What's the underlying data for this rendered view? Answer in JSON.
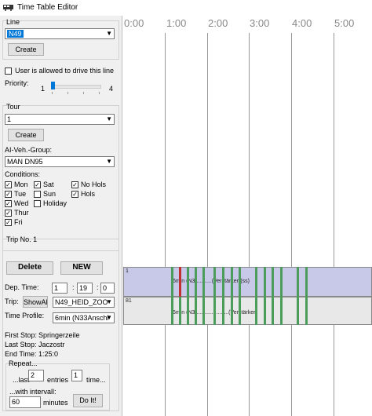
{
  "window": {
    "title": "Time Table Editor"
  },
  "line": {
    "group_label": "Line",
    "value": "N49",
    "create_label": "Create"
  },
  "permission": {
    "label": "User is allowed to drive this line",
    "checked": false
  },
  "priority": {
    "label": "Priority:",
    "min": "1",
    "max": "4",
    "value": 1
  },
  "tour": {
    "group_label": "Tour",
    "value": "1",
    "create_label": "Create"
  },
  "vehicle": {
    "label": "AI-Veh.-Group:",
    "value": "MAN DN95"
  },
  "conditions": {
    "label": "Conditions:",
    "items": [
      {
        "label": "Mon",
        "checked": true
      },
      {
        "label": "Tue",
        "checked": true
      },
      {
        "label": "Wed",
        "checked": true
      },
      {
        "label": "Thur",
        "checked": true
      },
      {
        "label": "Fri",
        "checked": true
      },
      {
        "label": "Sat",
        "checked": true
      },
      {
        "label": "Sun",
        "checked": false
      },
      {
        "label": "Holiday",
        "checked": false
      },
      {
        "label": "No Hols",
        "checked": true
      },
      {
        "label": "Hols",
        "checked": true
      }
    ]
  },
  "trip": {
    "group_label": "Trip No. 1",
    "delete_label": "Delete",
    "new_label": "NEW",
    "dep_label": "Dep. Time:",
    "dep_h": "1",
    "dep_m": "19",
    "dep_s": "0",
    "trip_label": "Trip:",
    "show_all_label": "ShowAl",
    "trip_value": "N49_HEID_ZOO",
    "profile_label": "Time Profile:",
    "profile_value": "6min (N33Anschl",
    "first_stop_label": "First Stop:",
    "first_stop": "Springerzeile",
    "last_stop_label": "Last Stop:",
    "last_stop": "Jaczostr",
    "end_time_label": "End Time:",
    "end_time": "1:25:0"
  },
  "repeat": {
    "group_label": "Repeat...",
    "last_label": "...last",
    "entries_value": "2",
    "entries_label": "entries",
    "time_value": "1",
    "time_label": "time...",
    "interval_label": "...with intervall:",
    "interval_value": "60",
    "minutes_label": "minutes",
    "doit_label": "Do It!"
  },
  "timeline": {
    "hours": [
      "0:00",
      "1:00",
      "2:00",
      "3:00",
      "4:00",
      "5:00"
    ],
    "row1_label": "1",
    "row2_label": "81",
    "row1_text": "6min (N3...........(Verstärker)(ss)",
    "row2_text": "6min (N3......................(Verstärker)",
    "colors": {
      "selected_row": "#c8c8e8",
      "other_row": "#e8e8e8",
      "stop_marker": "#4c9c5c",
      "current_marker": "#c03030"
    }
  }
}
